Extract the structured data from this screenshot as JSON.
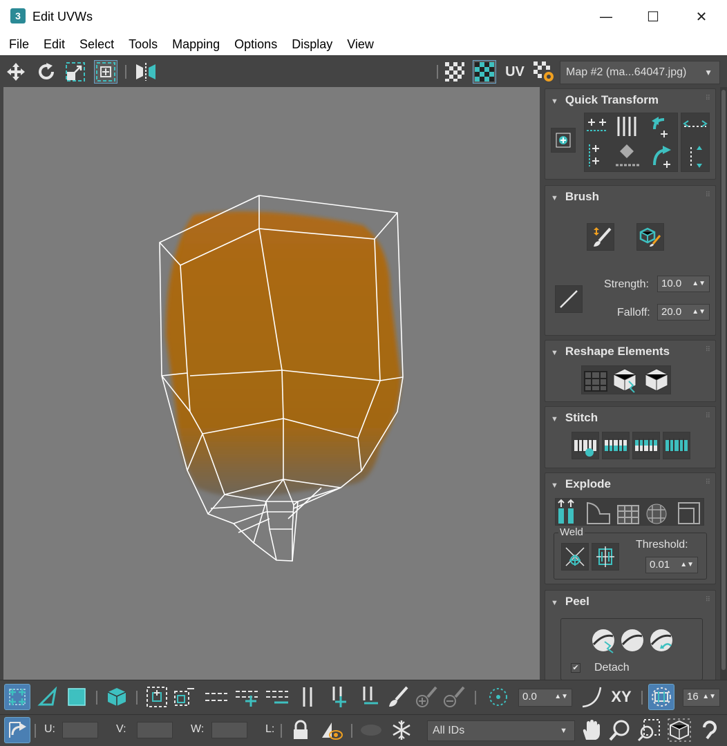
{
  "window": {
    "title": "Edit UVWs",
    "app_icon": "3",
    "controls": [
      "—",
      "☐",
      "✕"
    ]
  },
  "menu": [
    "File",
    "Edit",
    "Select",
    "Tools",
    "Mapping",
    "Options",
    "Display",
    "View"
  ],
  "toolbar": {
    "uv_label": "UV",
    "map_dropdown": "Map #2 (ma...64047.jpg)"
  },
  "panel": {
    "quick_transform": {
      "title": "Quick Transform"
    },
    "brush": {
      "title": "Brush",
      "strength_label": "Strength:",
      "strength_value": "10.0",
      "falloff_label": "Falloff:",
      "falloff_value": "20.0"
    },
    "reshape": {
      "title": "Reshape Elements"
    },
    "stitch": {
      "title": "Stitch"
    },
    "explode": {
      "title": "Explode",
      "weld_label": "Weld",
      "threshold_label": "Threshold:",
      "threshold_value": "0.01"
    },
    "peel": {
      "title": "Peel",
      "detach_label": "Detach",
      "detach_check": "✔"
    }
  },
  "bottom": {
    "angle_value": "0.0",
    "xy_label": "XY",
    "grid_value": "16",
    "u_label": "U:",
    "v_label": "V:",
    "w_label": "W:",
    "l_label": "L:",
    "ids_dropdown": "All IDs"
  },
  "colors": {
    "accent": "#3ec0c0",
    "viewport_bg": "#7c7c7c",
    "panel_bg": "#444444",
    "texture": "#b06a12"
  }
}
